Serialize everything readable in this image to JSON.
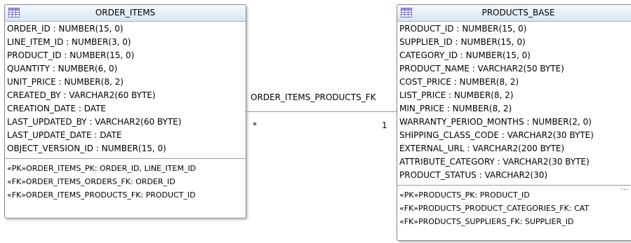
{
  "order_items": {
    "title": "ORDER_ITEMS",
    "columns": [
      "ORDER_ID : NUMBER(15, 0)",
      "LINE_ITEM_ID : NUMBER(3, 0)",
      "PRODUCT_ID : NUMBER(15, 0)",
      "QUANTITY : NUMBER(6, 0)",
      "UNIT_PRICE : NUMBER(8, 2)",
      "CREATED_BY : VARCHAR2(60 BYTE)",
      "CREATION_DATE : DATE",
      "LAST_UPDATED_BY : VARCHAR2(60 BYTE)",
      "LAST_UPDATE_DATE : DATE",
      "OBJECT_VERSION_ID : NUMBER(15, 0)"
    ],
    "keys": [
      "«PK»ORDER_ITEMS_PK: ORDER_ID, LINE_ITEM_ID",
      "«FK»ORDER_ITEMS_ORDERS_FK: ORDER_ID",
      "«FK»ORDER_ITEMS_PRODUCTS_FK: PRODUCT_ID"
    ]
  },
  "products_base": {
    "title": "PRODUCTS_BASE",
    "columns": [
      "PRODUCT_ID : NUMBER(15, 0)",
      "SUPPLIER_ID : NUMBER(15, 0)",
      "CATEGORY_ID : NUMBER(15, 0)",
      "PRODUCT_NAME : VARCHAR2(50 BYTE)",
      "COST_PRICE : NUMBER(8, 2)",
      "LIST_PRICE : NUMBER(8, 2)",
      "MIN_PRICE : NUMBER(8, 2)",
      "WARRANTY_PERIOD_MONTHS : NUMBER(2, 0)",
      "SHIPPING_CLASS_CODE : VARCHAR2(30 BYTE)",
      "EXTERNAL_URL : VARCHAR2(200 BYTE)",
      "ATTRIBUTE_CATEGORY : VARCHAR2(30 BYTE)",
      "PRODUCT_STATUS : VARCHAR2(30)"
    ],
    "more_indicator": "...",
    "keys": [
      "«PK»PRODUCTS_PK: PRODUCT_ID",
      "«FK»PRODUCTS_PRODUCT_CATEGORIES_FK: CAT",
      "«FK»PRODUCTS_SUPPLIERS_FK: SUPPLIER_ID"
    ]
  },
  "relationship": {
    "name": "ORDER_ITEMS_PRODUCTS_FK",
    "source_multiplicity": "*",
    "target_multiplicity": "1"
  },
  "colors": {
    "header_top": "#f4f9fd",
    "header_bottom": "#d6e6f4",
    "border": "#8a8a8a",
    "icon": "#7b6fd0"
  }
}
